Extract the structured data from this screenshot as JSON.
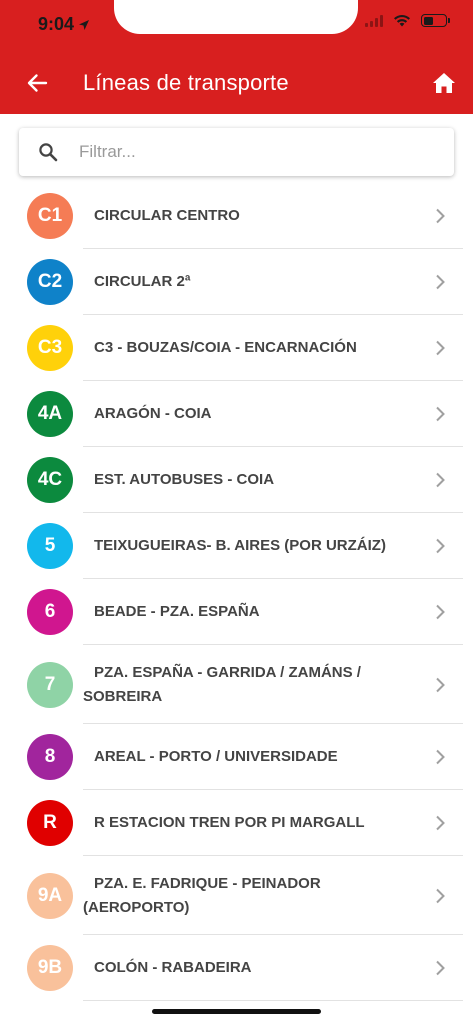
{
  "status": {
    "time": "9:04"
  },
  "header": {
    "title": "Líneas de transporte",
    "bg_color": "#d81f1f"
  },
  "search": {
    "placeholder": "Filtrar..."
  },
  "lines": [
    {
      "code": "C1",
      "name": "CIRCULAR CENTRO",
      "color": "#f57c55",
      "text_color": "#ffffff"
    },
    {
      "code": "C2",
      "name": "CIRCULAR 2ª",
      "color": "#0f82c9",
      "text_color": "#ffffff"
    },
    {
      "code": "C3",
      "name": "C3 - BOUZAS/COIA - ENCARNACIÓN",
      "color": "#ffd10a",
      "text_color": "#ffffff"
    },
    {
      "code": "4A",
      "name": "ARAGÓN - COIA",
      "color": "#0c8a3e",
      "text_color": "#ffffff"
    },
    {
      "code": "4C",
      "name": "EST. AUTOBUSES - COIA",
      "color": "#0c8a3e",
      "text_color": "#ffffff"
    },
    {
      "code": "5",
      "name": "TEIXUGUEIRAS- B. AIRES (POR URZÁIZ)",
      "color": "#12b8ec",
      "text_color": "#ffffff"
    },
    {
      "code": "6",
      "name": "BEADE - PZA. ESPAÑA",
      "color": "#d0168f",
      "text_color": "#ffffff"
    },
    {
      "code": "7",
      "name": "PZA. ESPAÑA - GARRIDA / ZAMÁNS / SOBREIRA",
      "color": "#8fd3a6",
      "text_color": "#ffffff"
    },
    {
      "code": "8",
      "name": "AREAL - PORTO / UNIVERSIDADE",
      "color": "#a1259d",
      "text_color": "#ffffff"
    },
    {
      "code": "R",
      "name": "R ESTACION TREN POR PI MARGALL",
      "color": "#e00000",
      "text_color": "#ffffff"
    },
    {
      "code": "9A",
      "name": "PZA. E. FADRIQUE - PEINADOR (AEROPORTO)",
      "color": "#f9c19b",
      "text_color": "#ffffff"
    },
    {
      "code": "9B",
      "name": "COLÓN - RABADEIRA",
      "color": "#f9c19b",
      "text_color": "#ffffff"
    }
  ]
}
